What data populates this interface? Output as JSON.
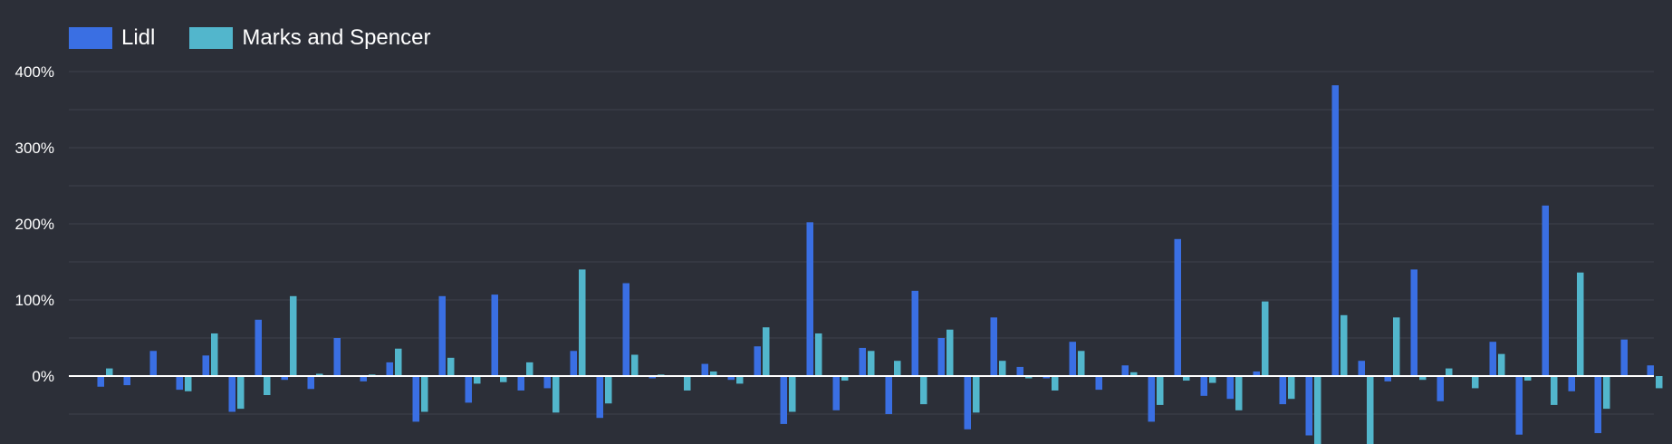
{
  "chart_data": {
    "type": "bar",
    "grid": true,
    "legend_placement": "top-left",
    "y_tick_labels": [
      "400%",
      "300%",
      "200%",
      "100%",
      "0%"
    ],
    "y_ticks": [
      400,
      300,
      200,
      100,
      0
    ],
    "ylim": [
      -90,
      400
    ],
    "colors": {
      "Lidl": "#3a6fe3",
      "Marks and Spencer": "#52b6cc",
      "background": "#2c2f38",
      "grid": "#3e414b",
      "zero_line": "#ffffff"
    },
    "series": [
      {
        "name": "Lidl",
        "values": [
          -14,
          -12,
          33,
          -18,
          27,
          -47,
          74,
          -5,
          -17,
          50,
          -7,
          18,
          -60,
          105,
          -35,
          107,
          -19,
          -16,
          33,
          -55,
          122,
          -3,
          -1,
          16,
          -5,
          39,
          -63,
          202,
          -45,
          37,
          -50,
          112,
          50,
          -70,
          77,
          12,
          -3,
          45,
          -18,
          14,
          -60,
          180,
          -26,
          -30,
          6,
          -37,
          -78,
          382,
          20,
          -7,
          140,
          -33,
          -1,
          45,
          -77,
          224,
          -20,
          -75,
          48,
          14
        ]
      },
      {
        "name": "Marks and Spencer",
        "values": [
          10,
          1,
          1,
          -20,
          56,
          -43,
          -25,
          105,
          3,
          1,
          2,
          36,
          -47,
          24,
          -10,
          -8,
          18,
          -48,
          140,
          -36,
          28,
          2,
          -19,
          6,
          -10,
          64,
          -47,
          56,
          -6,
          33,
          20,
          -37,
          61,
          -48,
          20,
          -3,
          -19,
          33,
          1,
          5,
          -38,
          -6,
          -9,
          -45,
          98,
          -30,
          -92,
          80,
          -90,
          77,
          -5,
          10,
          -16,
          29,
          -6,
          -38,
          136,
          -43,
          1,
          -16
        ]
      }
    ]
  }
}
